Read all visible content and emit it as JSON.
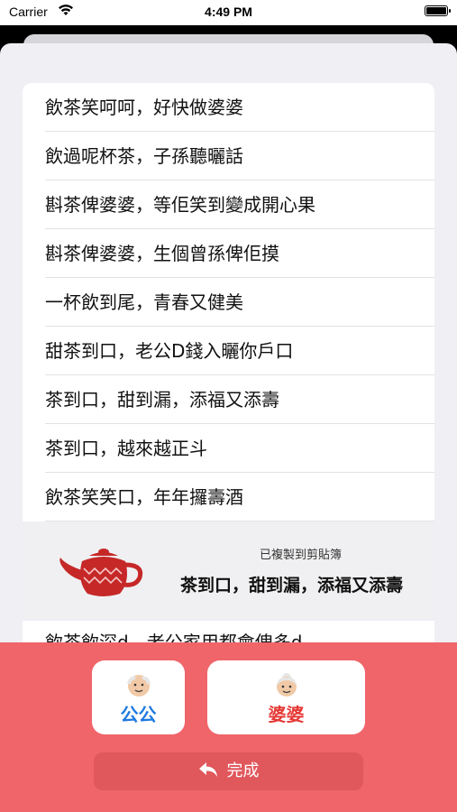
{
  "status_bar": {
    "carrier": "Carrier",
    "time": "4:49 PM"
  },
  "phrases": [
    "飲茶笑呵呵，好快做婆婆",
    "飲過呢杯茶，子孫聽曬話",
    "斟茶俾婆婆，等佢笑到變成開心果",
    "斟茶俾婆婆，生個曾孫俾佢摸",
    "一杯飲到尾，青春又健美",
    "甜茶到口，老公D錢入曬你戶口",
    "茶到口，甜到漏，添福又添壽",
    "茶到口，越來越正斗",
    "飲茶笑笑口，年年攞壽酒"
  ],
  "peek_phrase": "飲茶飲深d，老公家用都會俾多d",
  "toast": {
    "caption": "已複製到剪貼簿",
    "text": "茶到口，甜到漏，添福又添壽"
  },
  "buttons": {
    "grandpa": "公公",
    "grandma": "婆婆",
    "done": "完成"
  },
  "colors": {
    "panel": "#f0656a",
    "grandpa_label": "#1f7ae0",
    "grandma_label": "#e53935"
  },
  "icons": {
    "teapot": "teapot-icon",
    "grandpa": "old-man-icon",
    "grandma": "old-woman-icon",
    "done": "reply-arrow-icon"
  }
}
